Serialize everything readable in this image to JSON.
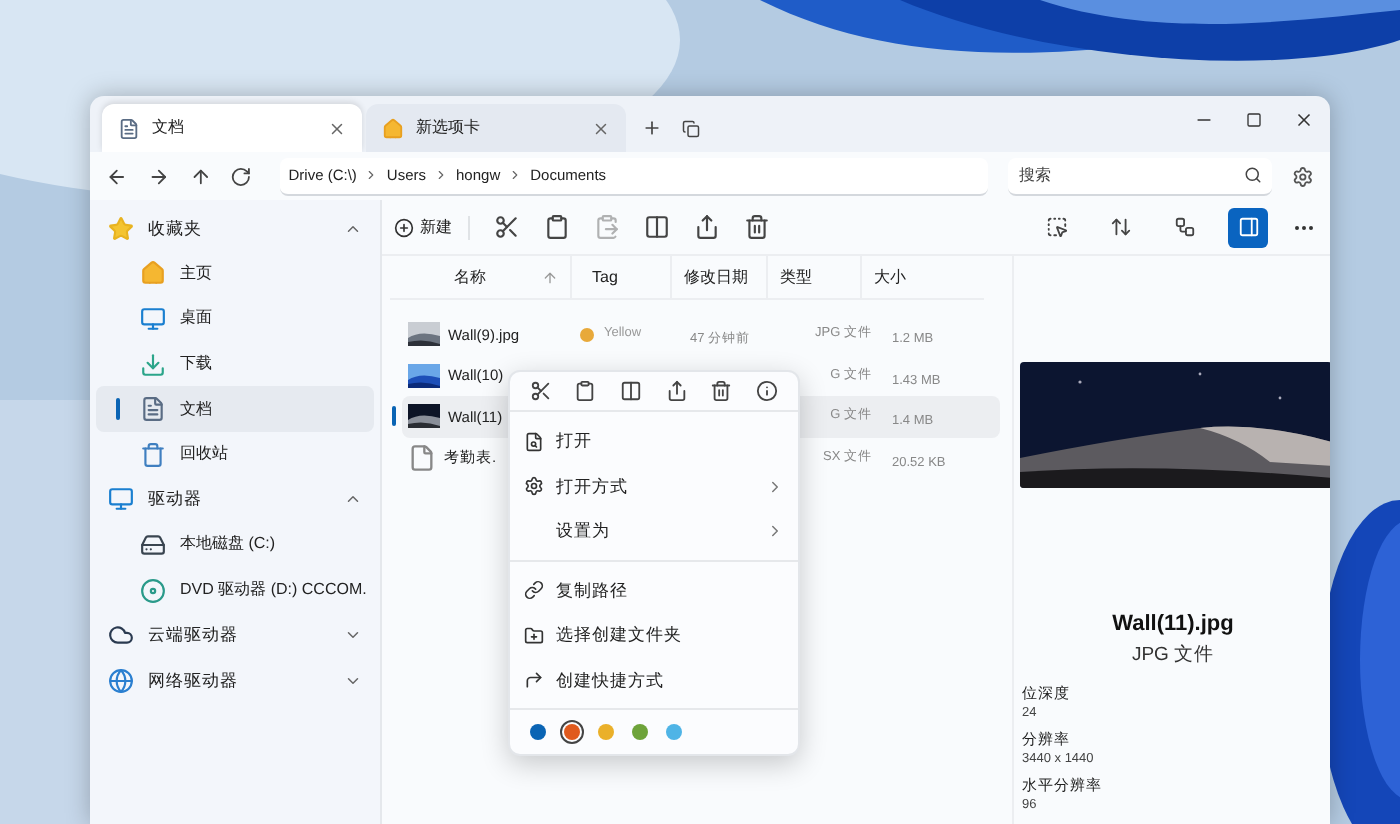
{
  "tabs": [
    {
      "label": "文档",
      "selected": true
    },
    {
      "label": "新选项卡",
      "selected": false
    }
  ],
  "breadcrumb": [
    "Drive (C:\\)",
    "Users",
    "hongw",
    "Documents"
  ],
  "search": {
    "placeholder": "搜索"
  },
  "toolbar": {
    "new_label": "新建",
    "view_buttons": [
      {
        "selected": false
      },
      {
        "selected": false
      },
      {
        "selected": false
      },
      {
        "selected": true
      }
    ]
  },
  "sidebar": [
    {
      "label": "收藏夹",
      "expanded": true,
      "children": [
        {
          "label": "主页",
          "selected": false
        },
        {
          "label": "桌面",
          "selected": false
        },
        {
          "label": "下载",
          "selected": false
        },
        {
          "label": "文档",
          "selected": true
        },
        {
          "label": "回收站",
          "selected": false
        }
      ]
    },
    {
      "label": "驱动器",
      "expanded": true,
      "children": [
        {
          "label": "本地磁盘 (C:)",
          "selected": false
        },
        {
          "label": "DVD 驱动器 (D:) CCCOM.",
          "selected": false
        }
      ]
    },
    {
      "label": "云端驱动器",
      "expanded": false
    },
    {
      "label": "网络驱动器",
      "expanded": false
    }
  ],
  "table": {
    "columns": [
      "名称",
      "Tag",
      "修改日期",
      "类型",
      "大小"
    ],
    "rows": [
      {
        "name": "Wall(9).jpg",
        "tag": {
          "label": "Yellow",
          "color": "#e8a93a"
        },
        "modified": "47 分钟前",
        "type": "JPG 文件",
        "size": "1.2 MB",
        "selected": false
      },
      {
        "name": "Wall(10)",
        "type": "G 文件",
        "size": "1.43 MB",
        "selected": false
      },
      {
        "name": "Wall(11)",
        "type": "G 文件",
        "size": "1.4 MB",
        "selected": true
      },
      {
        "kind": "document",
        "name": "考勤表.",
        "type": "SX 文件",
        "size": "20.52 KB",
        "selected": false
      }
    ]
  },
  "context_menu": {
    "groups": [
      [
        {
          "label": "打开",
          "submenu": false
        },
        {
          "label": "打开方式",
          "submenu": true
        },
        {
          "label": "设置为",
          "submenu": true
        }
      ],
      [
        {
          "label": "复制路径",
          "submenu": false
        },
        {
          "label": "选择创建文件夹",
          "submenu": false
        },
        {
          "label": "创建快捷方式",
          "submenu": false
        }
      ]
    ],
    "colors": [
      {
        "color": "#0a64b4",
        "selected": false
      },
      {
        "color": "#e05a1e",
        "selected": true
      },
      {
        "color": "#eab02a",
        "selected": false
      },
      {
        "color": "#6ea33a",
        "selected": false
      },
      {
        "color": "#4fb4e6",
        "selected": false
      }
    ]
  },
  "preview": {
    "kind": "picture",
    "title": "Wall(11).jpg",
    "type": "JPG 文件",
    "properties": [
      {
        "label": "位深度",
        "value": "24"
      },
      {
        "label": "分辨率",
        "value": "3440 x 1440"
      },
      {
        "label": "水平分辨率",
        "value": "96"
      }
    ]
  }
}
